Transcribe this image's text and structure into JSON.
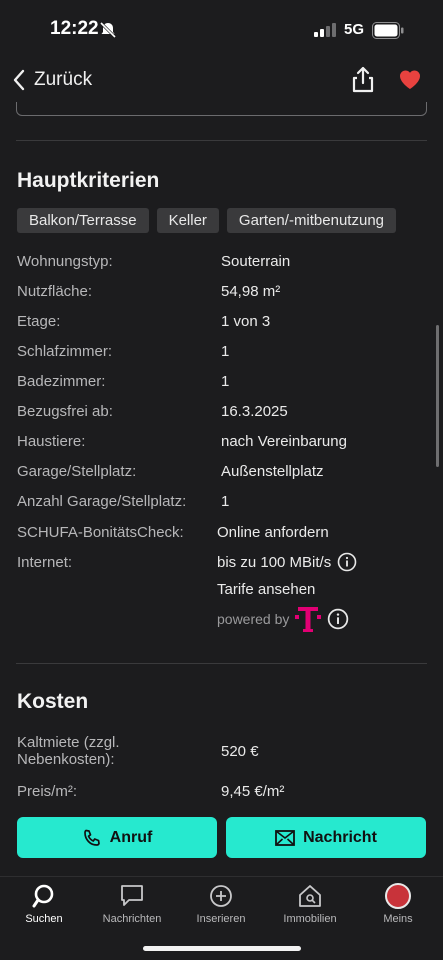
{
  "status": {
    "time": "12:22",
    "network": "5G"
  },
  "header": {
    "back_label": "Zurück",
    "share_icon": "share-icon",
    "favorite_icon": "heart-icon",
    "accent": "#e8423f"
  },
  "main": {
    "heading": "Hauptkriterien",
    "tags": [
      "Balkon/Terrasse",
      "Keller",
      "Garten/-mitbenutzung"
    ],
    "details": [
      {
        "key": "Wohnungstyp:",
        "value": "Souterrain"
      },
      {
        "key": "Nutzfläche:",
        "value": "54,98 m²"
      },
      {
        "key": "Etage:",
        "value": "1 von 3"
      },
      {
        "key": "Schlafzimmer:",
        "value": "1"
      },
      {
        "key": "Badezimmer:",
        "value": "1"
      },
      {
        "key": "Bezugsfrei ab:",
        "value": "16.3.2025"
      },
      {
        "key": "Haustiere:",
        "value": "nach Vereinbarung"
      },
      {
        "key": "Garage/Stellplatz:",
        "value": "Außenstellplatz"
      },
      {
        "key": "Anzahl Garage/Stellplatz:",
        "value": "1"
      }
    ],
    "schufa": {
      "key": "SCHUFA-BonitätsCheck:",
      "link": "Online anfordern"
    },
    "internet": {
      "key": "Internet:",
      "value": "bis zu 100 MBit/s",
      "link": "Tarife ansehen",
      "powered_by": "powered by"
    }
  },
  "costs": {
    "heading": "Kosten",
    "rows": [
      {
        "key": "Kaltmiete (zzgl.",
        "key2": "Nebenkosten):",
        "value": "520 €"
      },
      {
        "key": "Preis/m²:",
        "value": "9,45 €/m²"
      }
    ]
  },
  "actions": {
    "call_label": "Anruf",
    "message_label": "Nachricht",
    "color": "#26e9cf"
  },
  "tabbar": {
    "items": [
      {
        "label": "Suchen",
        "icon": "search-icon",
        "active": true
      },
      {
        "label": "Nachrichten",
        "icon": "chat-icon",
        "active": false
      },
      {
        "label": "Inserieren",
        "icon": "plus-circle-icon",
        "active": false
      },
      {
        "label": "Immobilien",
        "icon": "house-icon",
        "active": false
      },
      {
        "label": "Meins",
        "icon": "avatar",
        "active": false
      }
    ]
  }
}
